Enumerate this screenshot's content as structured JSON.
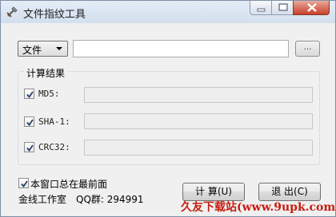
{
  "window": {
    "title": "文件指纹工具"
  },
  "titlebar_buttons": {
    "minimize_icon": "minimize-icon",
    "maximize_icon": "maximize-icon",
    "close_icon": "close-icon"
  },
  "source": {
    "type_selected": "文件",
    "path_value": "",
    "browse_label": "..."
  },
  "results": {
    "group_title": "计算结果",
    "items": [
      {
        "label": "MD5:",
        "checked": true,
        "value": ""
      },
      {
        "label": "SHA-1:",
        "checked": true,
        "value": ""
      },
      {
        "label": "CRC32:",
        "checked": true,
        "value": ""
      }
    ]
  },
  "options": {
    "always_on_top_label": "本窗口总在最前面",
    "always_on_top_checked": true
  },
  "footer": {
    "studio": "金线工作室",
    "qq_group": "QQ群: 294991"
  },
  "buttons": {
    "calculate": "计 算(U)",
    "exit": "退 出(C)"
  },
  "watermark": {
    "text": "久友下载站(www.9upk.com)"
  },
  "colors": {
    "watermark": "#c41e12",
    "close_button": "#c7412b",
    "titlebar": "#d3dfee"
  }
}
